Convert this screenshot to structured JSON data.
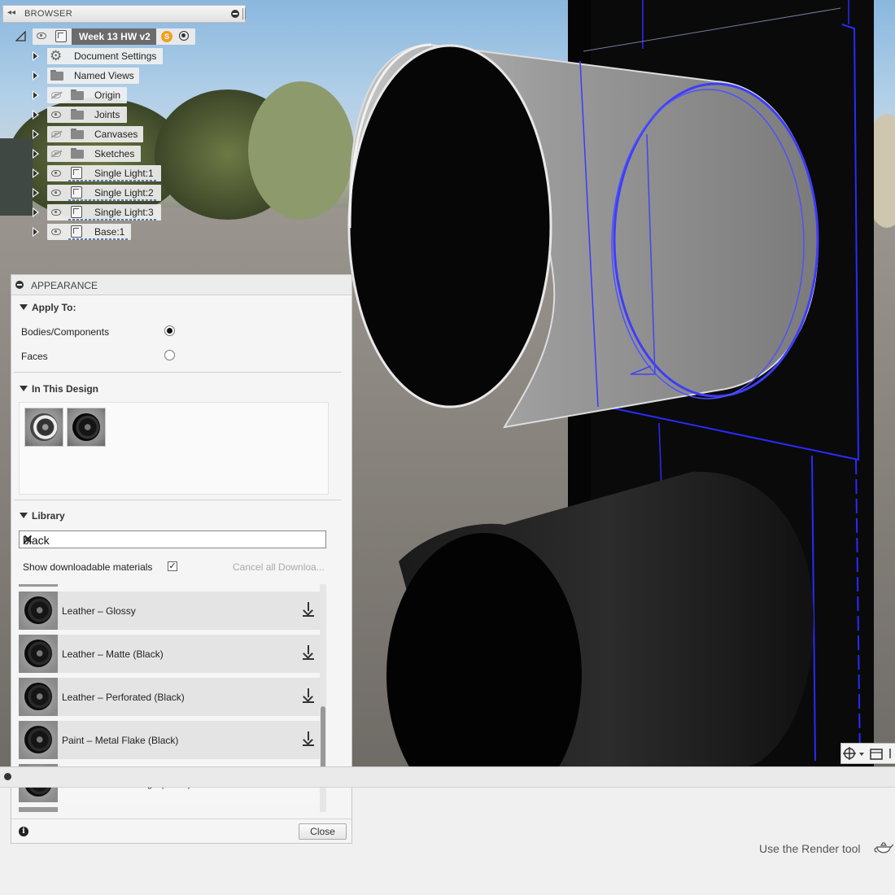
{
  "browser": {
    "title": "BROWSER",
    "root": "Week 13 HW v2",
    "items": [
      {
        "label": "Document Settings",
        "icon": "gear-icon",
        "eye": "none"
      },
      {
        "label": "Named Views",
        "icon": "folder-icon",
        "eye": "none"
      },
      {
        "label": "Origin",
        "icon": "folder-icon",
        "eye": "hidden"
      },
      {
        "label": "Joints",
        "icon": "folder-icon",
        "eye": "visible"
      },
      {
        "label": "Canvases",
        "icon": "folder-icon",
        "eye": "hidden"
      },
      {
        "label": "Sketches",
        "icon": "folder-icon",
        "eye": "hidden"
      },
      {
        "label": "Single Light:1",
        "icon": "component-icon",
        "eye": "visible"
      },
      {
        "label": "Single Light:2",
        "icon": "component-icon",
        "eye": "visible"
      },
      {
        "label": "Single Light:3",
        "icon": "component-icon",
        "eye": "visible"
      },
      {
        "label": "Base:1",
        "icon": "component-icon",
        "eye": "visible"
      }
    ]
  },
  "appearance": {
    "title": "APPEARANCE",
    "apply_to": {
      "heading": "Apply To:",
      "options": [
        {
          "label": "Bodies/Components",
          "selected": true
        },
        {
          "label": "Faces",
          "selected": false
        }
      ]
    },
    "in_this_design": {
      "heading": "In This Design"
    },
    "library": {
      "heading": "Library",
      "search_value": "black",
      "show_downloadable_label": "Show downloadable materials",
      "show_downloadable_checked": true,
      "cancel_downloads_label": "Cancel all Downloa...",
      "materials": [
        {
          "name": "Leather – Glossy",
          "downloadable": true
        },
        {
          "name": "Leather – Matte (Black)",
          "downloadable": true
        },
        {
          "name": "Leather – Perforated (Black)",
          "downloadable": true
        },
        {
          "name": "Paint – Metal Flake (Black)",
          "downloadable": true
        },
        {
          "name": "Powder Coat – Rough (Black)",
          "downloadable": false
        }
      ]
    },
    "close_label": "Close"
  },
  "status": {
    "render_tip": "Use the Render tool"
  },
  "colors": {
    "selection_blue": "#2a2aff",
    "panel_bg": "#f5f5f5",
    "badge_orange": "#f0a020"
  }
}
